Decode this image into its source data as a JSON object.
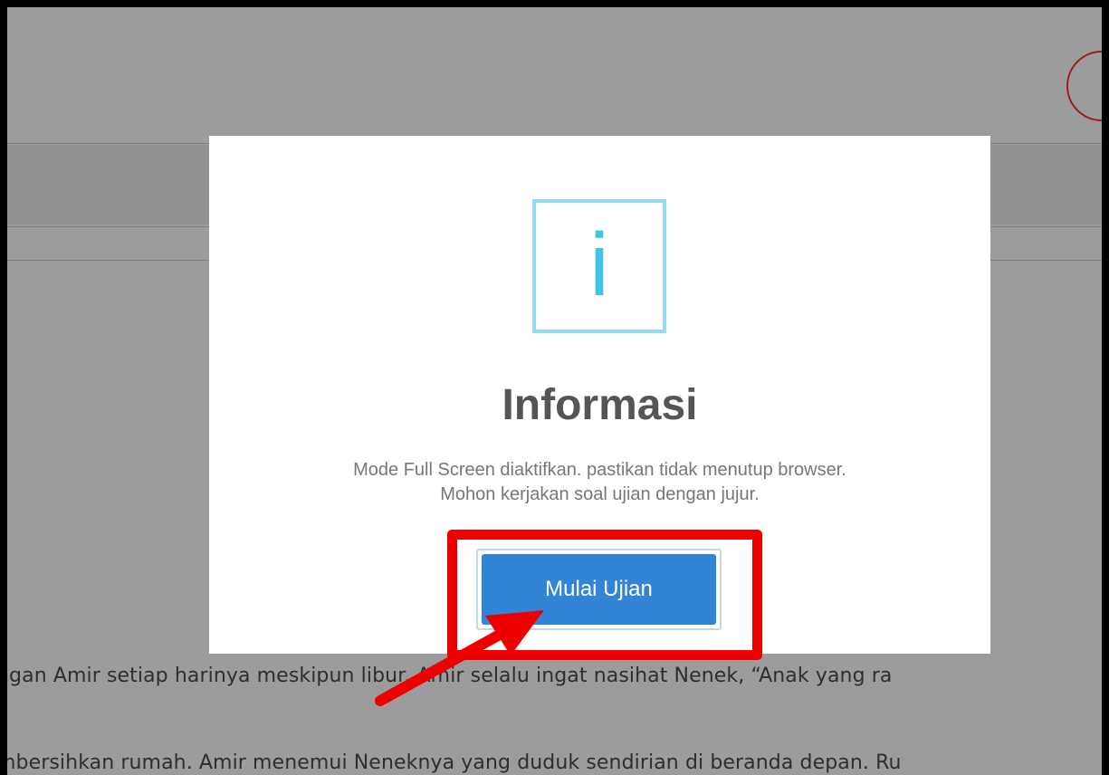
{
  "background": {
    "text_line_1": "ngan Amir setiap harinya meskipun libur. Amir selalu ingat nasihat Nenek, “Anak yang ra",
    "text_line_2": "mbersihkan rumah. Amir menemui Neneknya yang duduk sendirian di beranda depan. Ru"
  },
  "modal": {
    "icon": "info-icon",
    "icon_glyph": "i",
    "title": "Informasi",
    "message_line_1": "Mode Full Screen diaktifkan. pastikan tidak menutup browser.",
    "message_line_2": "Mohon kerjakan soal ujian dengan jujur.",
    "button_label": "Mulai Ujian"
  },
  "colors": {
    "overlay": "#9c9c9c",
    "button": "#3285d6",
    "icon": "#45c2ea",
    "highlight": "#ee0000"
  }
}
